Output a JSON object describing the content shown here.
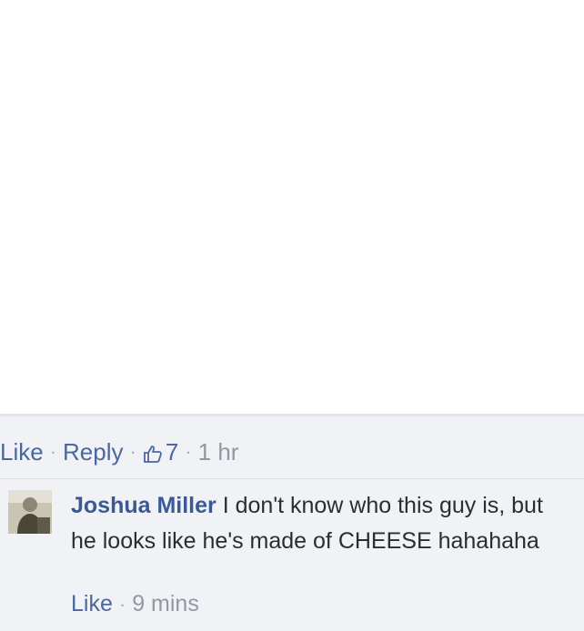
{
  "top_actions": {
    "like_label": "Like",
    "reply_label": "Reply",
    "like_count": "7",
    "timestamp": "1 hr",
    "separator": "·"
  },
  "reply": {
    "author": "Joshua Miller",
    "text": "I don't know who this guy is, but he looks like he's made of CHEESE hahahaha",
    "like_label": "Like",
    "timestamp": "9 mins"
  },
  "icons": {
    "thumb": "thumbs-up-icon",
    "avatar": "profile-photo"
  },
  "colors": {
    "link": "#4b67a1",
    "author": "#3b5998",
    "muted": "#9197a3",
    "panel_background": "#f1f2f6"
  }
}
